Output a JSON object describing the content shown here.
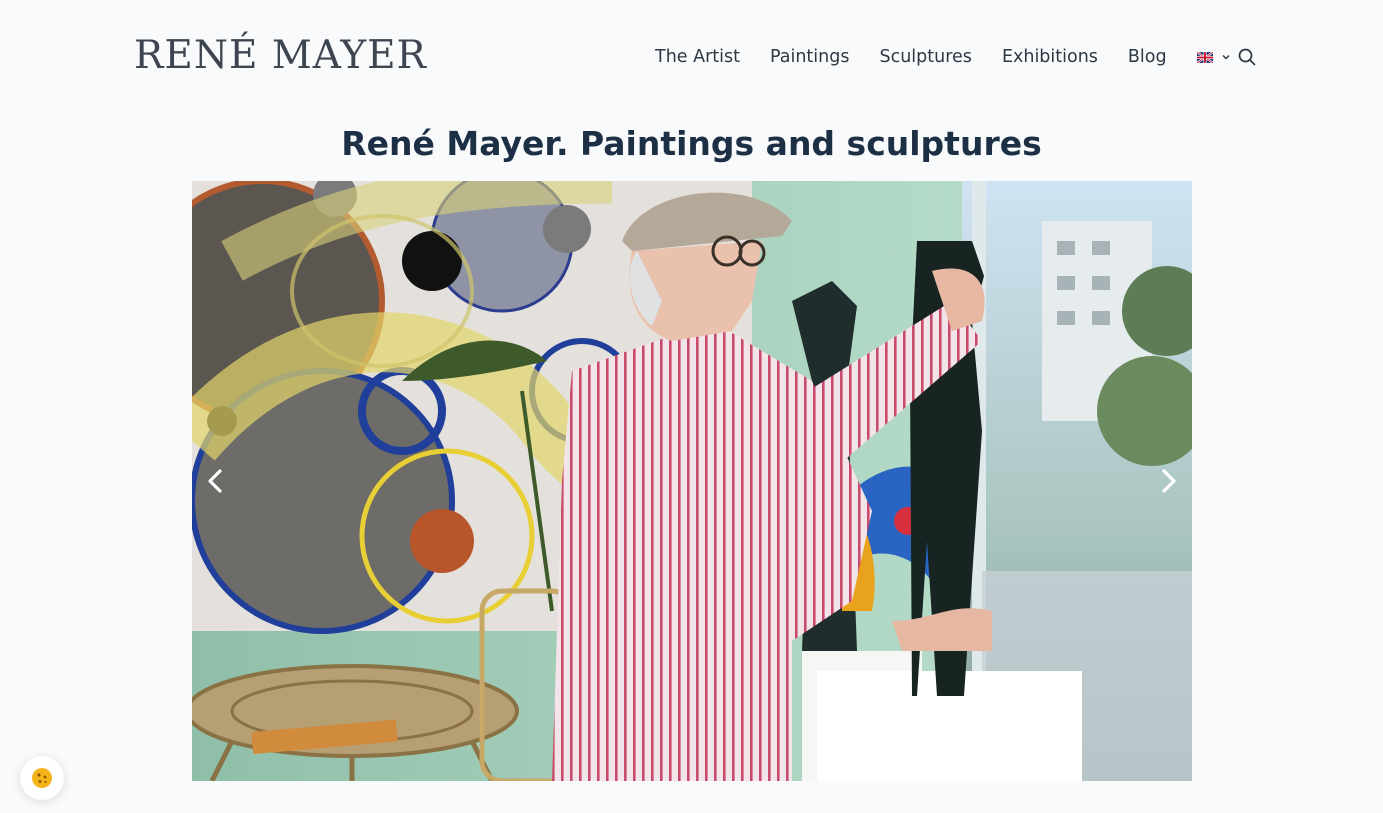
{
  "header": {
    "logo": "RENÉ MAYER",
    "nav": [
      "The Artist",
      "Paintings",
      "Sculptures",
      "Exhibitions",
      "Blog"
    ],
    "language_icon": "uk-flag-icon"
  },
  "main": {
    "title": "René Mayer. Paintings and sculptures",
    "slider": {
      "prev_icon": "chevron-left-icon",
      "next_icon": "chevron-right-icon"
    }
  },
  "cookie_icon": "cookie-icon",
  "colors": {
    "text": "#1c2f44",
    "background": "#f9fafb",
    "cookie": "#f4b41a"
  }
}
